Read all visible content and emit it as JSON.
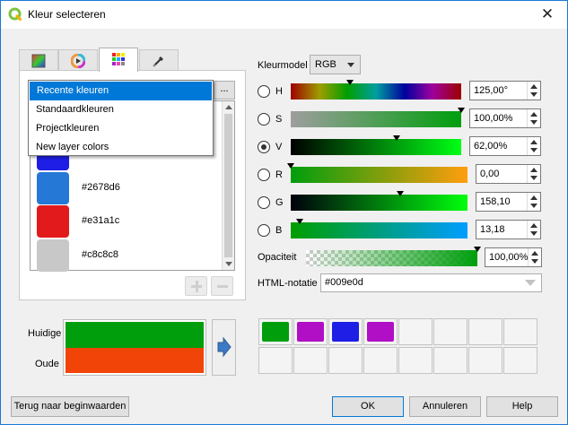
{
  "window": {
    "title": "Kleur selecteren"
  },
  "tabs": [
    {
      "icon": "color-ramp-icon"
    },
    {
      "icon": "color-wheel-icon"
    },
    {
      "icon": "color-swatches-icon"
    },
    {
      "icon": "eyedropper-icon"
    }
  ],
  "dropdown": {
    "items": [
      "Recente kleuren",
      "Standaardkleuren",
      "Projectkleuren",
      "New layer colors"
    ],
    "selected": "Recente kleuren",
    "more_label": "..."
  },
  "swatches": [
    {
      "color": "#1e1ee6",
      "label": "#1e1ee6"
    },
    {
      "color": "#2678d6",
      "label": "#2678d6"
    },
    {
      "color": "#e31a1c",
      "label": "#e31a1c"
    },
    {
      "color": "#c8c8c8",
      "label": "#c8c8c8"
    }
  ],
  "model": {
    "label": "Kleurmodel",
    "value": "RGB"
  },
  "components": [
    {
      "letter": "H",
      "value": "125,00°",
      "level": 0.347,
      "checked": false
    },
    {
      "letter": "S",
      "value": "100,00%",
      "level": 1.0,
      "checked": false
    },
    {
      "letter": "V",
      "value": "62,00%",
      "level": 0.62,
      "checked": true
    },
    {
      "letter": "R",
      "value": "0,00",
      "level": 0.0,
      "checked": false
    },
    {
      "letter": "G",
      "value": "158,10",
      "level": 0.62,
      "checked": false
    },
    {
      "letter": "B",
      "value": "13,18",
      "level": 0.052,
      "checked": false
    }
  ],
  "opacity": {
    "label": "Opaciteit",
    "value": "100,00%",
    "level": 1.0
  },
  "html_notation": {
    "label": "HTML-notatie",
    "value": "#009e0d"
  },
  "preview": {
    "current_label": "Huidige",
    "old_label": "Oude",
    "current_color": "#009e0d",
    "old_color": "#f04408"
  },
  "wells": [
    "#009e0d",
    "#b10fc6",
    "#1e1ee6",
    "#b10fc6"
  ],
  "buttons": {
    "reset": "Terug naar beginwaarden",
    "ok": "OK",
    "cancel": "Annuleren",
    "help": "Help"
  }
}
